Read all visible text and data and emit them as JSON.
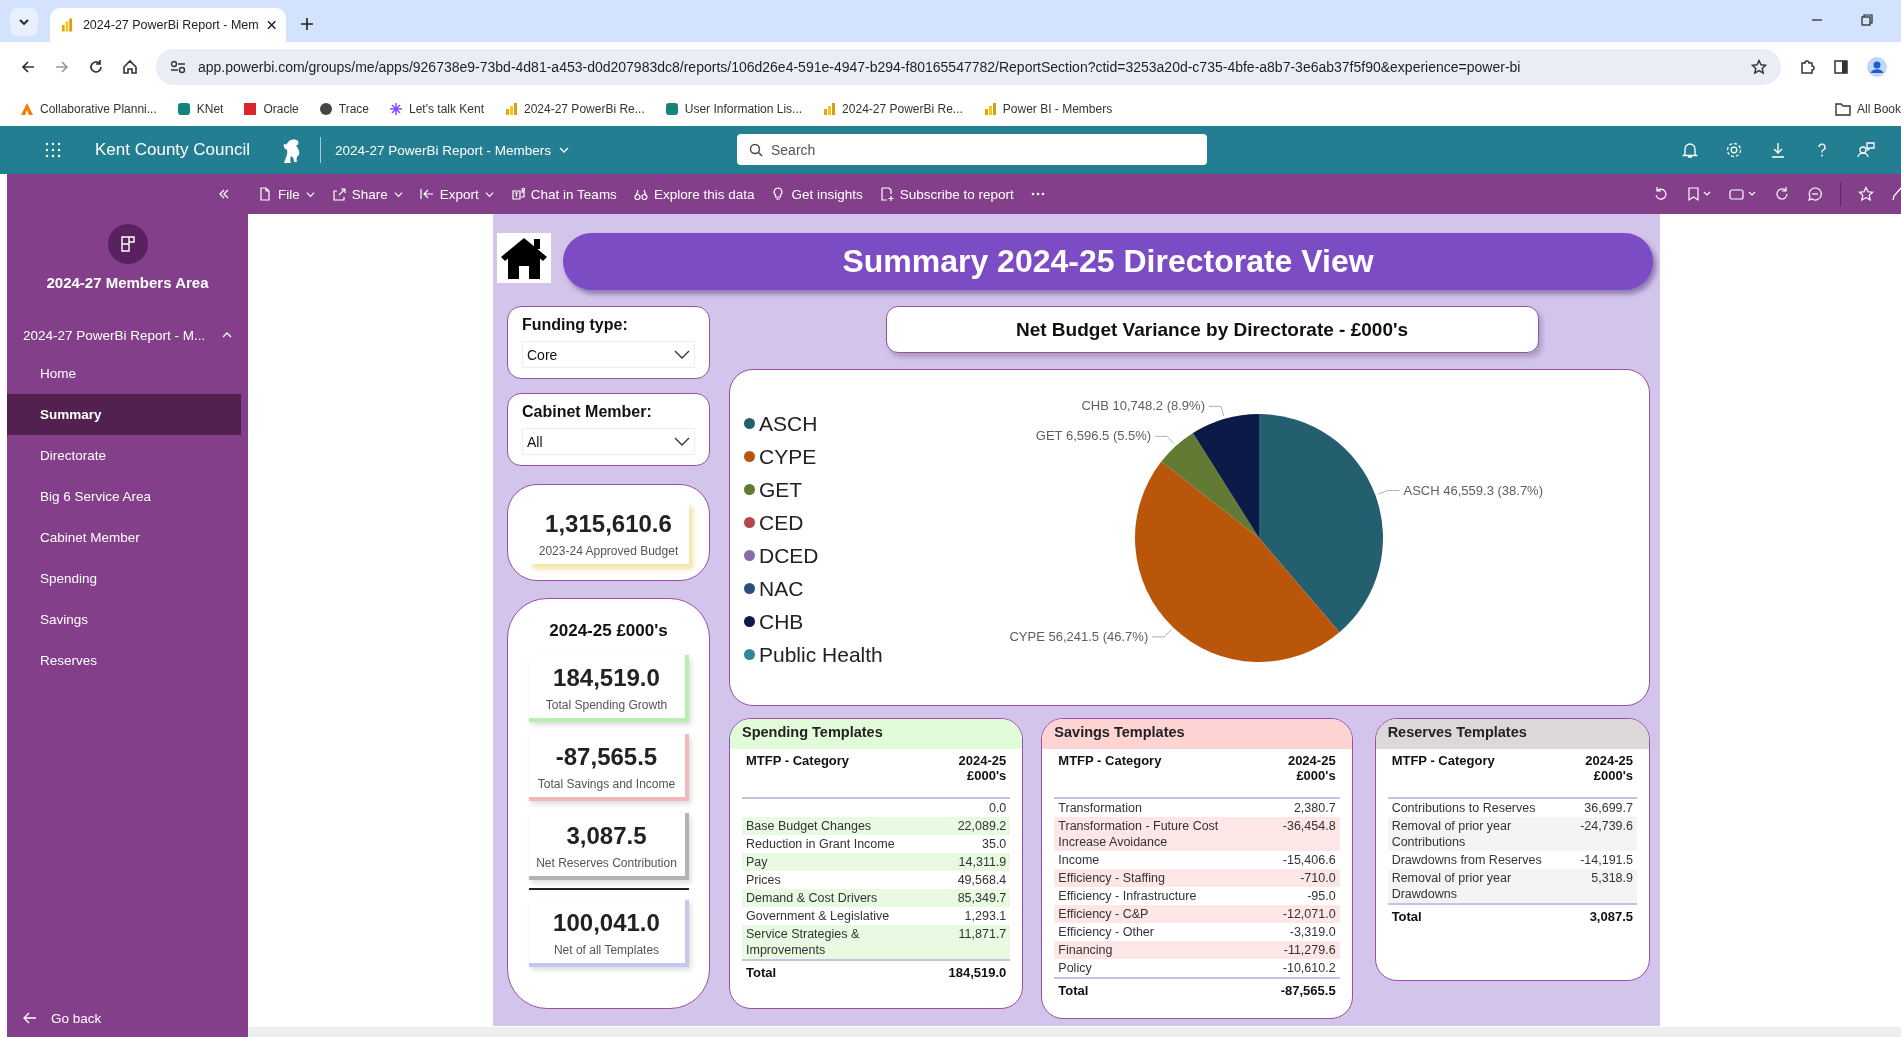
{
  "browser": {
    "tab_title": "2024-27 PowerBi Report - Mem",
    "url": "app.powerbi.com/groups/me/apps/926738e9-73bd-4d81-a453-d0d207983dc8/reports/106d26e4-591e-4947-b294-f80165547782/ReportSection?ctid=3253a20d-c735-4bfe-a8b7-3e6ab37f5f90&experience=power-bi",
    "bookmarks": [
      "Collaborative Planni...",
      "KNet",
      "Oracle",
      "Trace",
      "Let's talk Kent",
      "2024-27 PowerBi Re...",
      "User Information Lis...",
      "2024-27 PowerBi Re...",
      "Power BI - Members"
    ],
    "all_bookmarks": "All Book"
  },
  "app_bar": {
    "org": "Kent County Council",
    "report": "2024-27 PowerBi Report - Members",
    "search": {
      "placeholder": "Search"
    }
  },
  "toolbar": [
    {
      "label": "File",
      "menu": true
    },
    {
      "label": "Share",
      "menu": true
    },
    {
      "label": "Export",
      "menu": true
    },
    {
      "label": "Chat in Teams",
      "menu": false
    },
    {
      "label": "Explore this data",
      "menu": false
    },
    {
      "label": "Get insights",
      "menu": false
    },
    {
      "label": "Subscribe to report",
      "menu": false
    }
  ],
  "sidebar": {
    "title": "2024-27 Members Area",
    "section": {
      "label": "2024-27 PowerBi Report - M...",
      "expanded": true
    },
    "items": [
      {
        "label": "Home",
        "selected": false
      },
      {
        "label": "Summary",
        "selected": true
      },
      {
        "label": "Directorate",
        "selected": false
      },
      {
        "label": "Big 6 Service Area",
        "selected": false
      },
      {
        "label": "Cabinet Member",
        "selected": false
      },
      {
        "label": "Spending",
        "selected": false
      },
      {
        "label": "Savings",
        "selected": false
      },
      {
        "label": "Reserves",
        "selected": false
      }
    ],
    "back": "Go back"
  },
  "report": {
    "title": "Summary 2024-25 Directorate View",
    "slicers": [
      {
        "label": "Funding type:",
        "value": "Core"
      },
      {
        "label": "Cabinet Member:",
        "value": "All"
      }
    ],
    "budget": {
      "value": "1,315,610.6",
      "label": "2023-24 Approved Budget"
    },
    "totals": {
      "title": "2024-25 £000's",
      "cards": [
        {
          "value": "184,519.0",
          "label": "Total Spending Growth",
          "color": "#b8eeb0",
          "kind": "template"
        },
        {
          "value": "-87,565.5",
          "label": "Total Savings and Income",
          "color": "#f3b8bd",
          "kind": "template"
        },
        {
          "value": "3,087.5",
          "label": "Net Reserves Contribution",
          "color": "#b4b4b4",
          "kind": "template"
        },
        {
          "value": "100,041.0",
          "label": "Net of all Templates",
          "color": "#c4c8f0",
          "kind": "net"
        }
      ]
    },
    "chart": {
      "chart_data": {
        "type": "pie",
        "title": "Net Budget Variance by Directorate - £000's",
        "legend": true,
        "categories": [
          "ASCH",
          "CYPE",
          "GET",
          "CED",
          "DCED",
          "NAC",
          "CHB",
          "Public Health"
        ],
        "colors": [
          "#235f6e",
          "#b9560a",
          "#637a35",
          "#b5464a",
          "#8c6bab",
          "#2d4f80",
          "#0c1a48",
          "#2f8899"
        ],
        "values": [
          46559.3,
          56241.5,
          6596.5,
          null,
          null,
          null,
          10748.2,
          null
        ],
        "value_labels": [
          "ASCH 46,559.3 (38.7%)",
          "CYPE 56,241.5 (46.7%)",
          "GET 6,596.5 (5.5%)",
          null,
          null,
          null,
          "CHB 10,748.2 (8.9%)",
          null
        ]
      }
    },
    "tables": [
      {
        "title": "Spending Templates",
        "kind": "spending",
        "columns": [
          "MTFP - Category",
          "2024-25 £000's"
        ],
        "rows": [
          {
            "value": "0.0"
          },
          {
            "label": "Base Budget Changes",
            "value": "22,089.2"
          },
          {
            "label": "Reduction in Grant Income",
            "value": "35.0"
          },
          {
            "label": "Pay",
            "value": "14,311.9"
          },
          {
            "label": "Prices",
            "value": "49,568.4"
          },
          {
            "label": "Demand & Cost Drivers",
            "value": "85,349.7"
          },
          {
            "label": "Government & Legislative",
            "value": "1,293.1"
          },
          {
            "label": "Service Strategies & Improvements",
            "value": "11,871.7"
          }
        ],
        "total": {
          "label": "Total",
          "value": "184,519.0"
        }
      },
      {
        "title": "Savings Templates",
        "kind": "savings",
        "columns": [
          "MTFP - Category",
          "2024-25 £000's"
        ],
        "rows": [
          {
            "label": "Transformation",
            "value": "2,380.7"
          },
          {
            "label": "Transformation - Future Cost Increase Avoidance",
            "value": "-36,454.8"
          },
          {
            "label": "Income",
            "value": "-15,406.6"
          },
          {
            "label": "Efficiency - Staffing",
            "value": "-710.0"
          },
          {
            "label": "Efficiency - Infrastructure",
            "value": "-95.0"
          },
          {
            "label": "Efficiency - C&P",
            "value": "-12,071.0"
          },
          {
            "label": "Efficiency - Other",
            "value": "-3,319.0"
          },
          {
            "label": "Financing",
            "value": "-11,279.6"
          },
          {
            "label": "Policy",
            "value": "-10,610.2"
          }
        ],
        "total": {
          "label": "Total",
          "value": "-87,565.5"
        }
      },
      {
        "title": "Reserves Templates",
        "kind": "reserves",
        "columns": [
          "MTFP - Category",
          "2024-25 £000's"
        ],
        "rows": [
          {
            "label": "Contributions to Reserves",
            "value": "36,699.7"
          },
          {
            "label": "Removal of prior year Contributions",
            "value": "-24,739.6"
          },
          {
            "label": "Drawdowns from Reserves",
            "value": "-14,191.5"
          },
          {
            "label": "Removal of prior year Drawdowns",
            "value": "5,318.9"
          }
        ],
        "total": {
          "label": "Total",
          "value": "3,087.5"
        }
      }
    ]
  }
}
